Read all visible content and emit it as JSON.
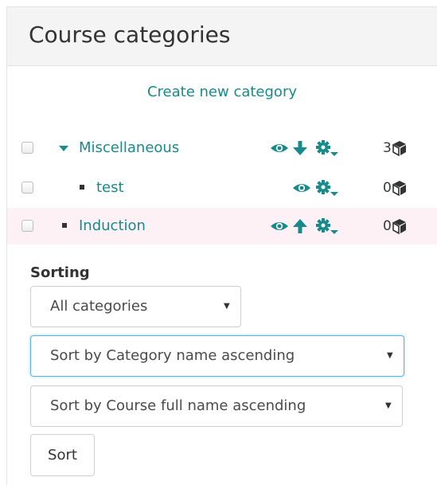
{
  "header": {
    "title": "Course categories"
  },
  "actions": {
    "create_category": "Create new category"
  },
  "categories": [
    {
      "name": "Miscellaneous",
      "count": "3",
      "expanded": true,
      "highlighted": false,
      "icons": [
        "eye-icon",
        "move-down-icon",
        "gear-menu-icon"
      ]
    },
    {
      "name": "test",
      "count": "0",
      "expanded": false,
      "highlighted": false,
      "icons": [
        "eye-icon",
        "gear-menu-icon"
      ]
    },
    {
      "name": "Induction",
      "count": "0",
      "expanded": false,
      "highlighted": true,
      "icons": [
        "eye-icon",
        "move-up-icon",
        "gear-menu-icon"
      ]
    }
  ],
  "sorting": {
    "label": "Sorting",
    "scope_select": "All categories",
    "category_sort_select": "Sort by Category name ascending",
    "course_sort_select": "Sort by Course full name ascending",
    "button_label": "Sort"
  },
  "colors": {
    "link": "#178b8b",
    "highlight_row": "#fdf1f5",
    "header_bg": "#f4f4f4",
    "focus_border": "#5ab4ea"
  }
}
